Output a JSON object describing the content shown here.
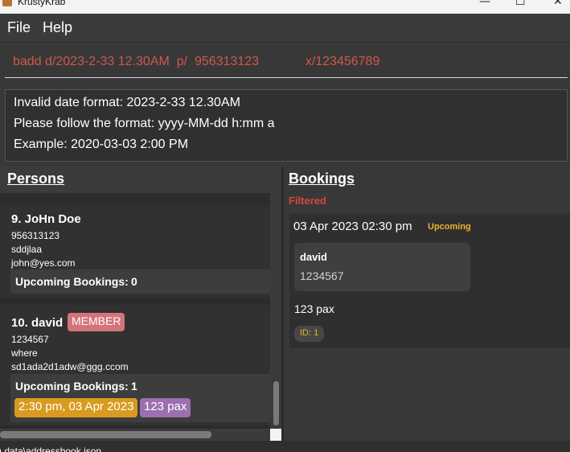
{
  "window": {
    "title": "KrustyKrab",
    "minimize": "—",
    "maximize": "☐",
    "close": "✕"
  },
  "menu": {
    "file": "File",
    "help": "Help"
  },
  "command": {
    "value": "badd d/2023-2-33 12.30AM  p/  956313123             x/123456789"
  },
  "result": {
    "line1": "Invalid date format: 2023-2-33 12.30AM",
    "line2": "Please follow the format: yyyy-MM-dd h:mm a",
    "line3": "Example: 2020-03-03 2:00 PM"
  },
  "persons": {
    "title": "Persons",
    "items": [
      {
        "name": "9. JoHn Doe",
        "phone": "956313123",
        "address": "sddjlaa",
        "email": "john@yes.com",
        "upcoming_label": "Upcoming Bookings:",
        "upcoming_count": "0"
      },
      {
        "name": "10. david",
        "tag": "MEMBER",
        "phone": "1234567",
        "address": "where",
        "email": "sd1ada2d1adw@ggg.ccom",
        "upcoming_label": "Upcoming Bookings:",
        "upcoming_count": "1",
        "booking_chip": "2:30 pm, 03 Apr 2023",
        "pax_chip": "123 pax"
      }
    ]
  },
  "bookings": {
    "title": "Bookings",
    "filter_label": "Filtered",
    "items": [
      {
        "date": "03 Apr 2023 02:30 pm",
        "status": "Upcoming",
        "person_name": "david",
        "person_phone": "1234567",
        "pax": "123 pax",
        "id": "ID: 1"
      }
    ]
  },
  "status": {
    "path": ") data\\addressbook.json"
  },
  "colors": {
    "error": "#d0574a",
    "filtered": "#d8473e",
    "upcoming": "#e8b32a",
    "member_tag": "#d4737a",
    "booking_chip": "#d89a1f",
    "pax_chip": "#9b6fb0"
  }
}
